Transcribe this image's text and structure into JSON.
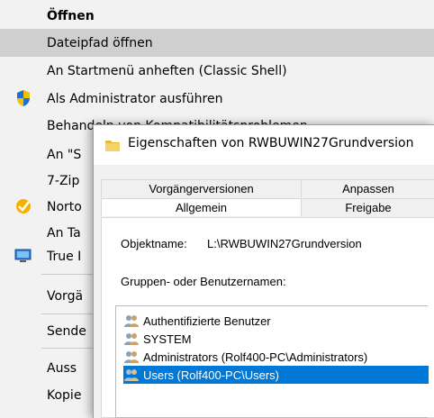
{
  "context_menu": {
    "items": [
      {
        "label": "Öffnen"
      },
      {
        "label": "Dateipfad öffnen"
      },
      {
        "label": "An Startmenü anheften (Classic Shell)"
      },
      {
        "label": "Als Administrator ausführen"
      },
      {
        "label": "Behandeln von Kompatibilitätsproblemen"
      },
      {
        "label": "An \"S"
      },
      {
        "label": "7-Zip"
      },
      {
        "label": "Norto"
      },
      {
        "label": "An Ta"
      },
      {
        "label": "True I"
      },
      {
        "label": "Vorgä"
      },
      {
        "label": "Sende"
      },
      {
        "label": "Auss"
      },
      {
        "label": "Kopie"
      }
    ]
  },
  "dialog": {
    "title": "Eigenschaften von RWBUWIN27Grundversion",
    "tabs_back": [
      "Vorgängerversionen",
      "Anpassen"
    ],
    "tabs_front": [
      "Allgemein",
      "Freigabe"
    ],
    "object_label": "Objektname:",
    "object_value": "L:\\RWBUWIN27Grundversion",
    "groups_label": "Gruppen- oder Benutzernamen:",
    "users": [
      {
        "name": "Authentifizierte Benutzer"
      },
      {
        "name": "SYSTEM"
      },
      {
        "name": "Administrators (Rolf400-PC\\Administrators)"
      },
      {
        "name": "Users (Rolf400-PC\\Users)"
      }
    ]
  },
  "colors": {
    "highlight": "#cfcfcf",
    "selection": "#0078d7"
  }
}
